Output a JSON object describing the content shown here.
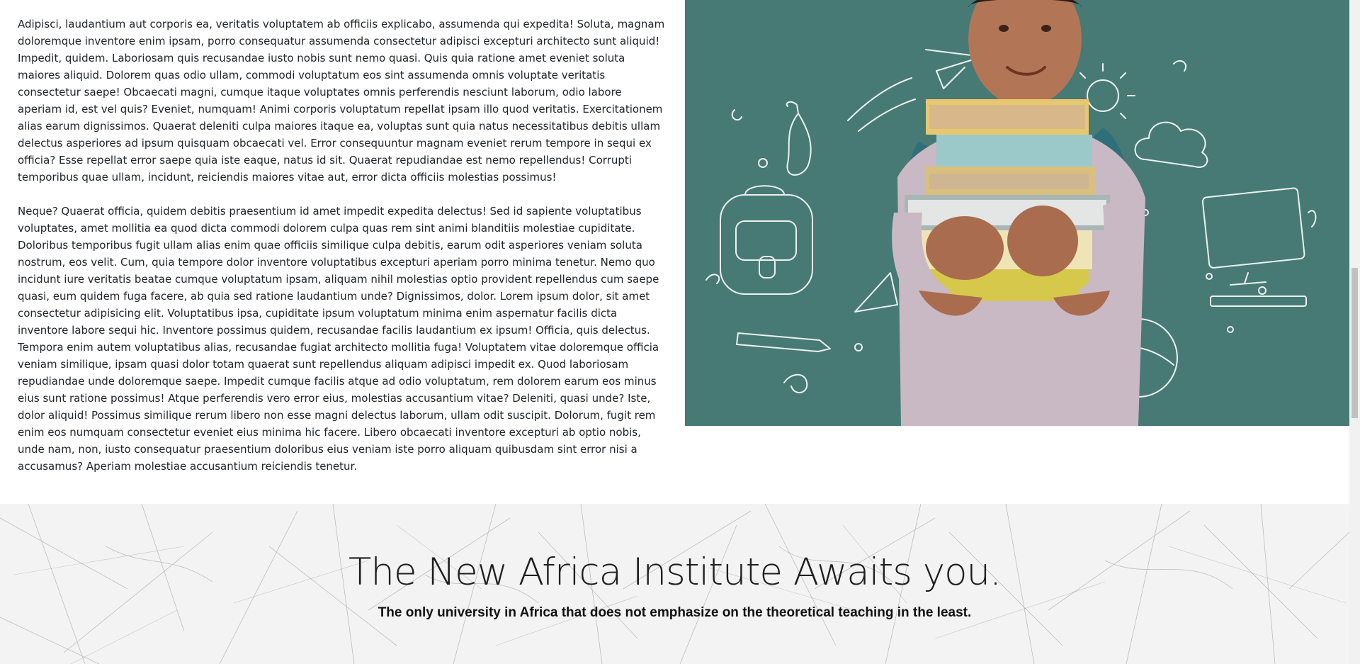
{
  "article": {
    "paragraphs": [
      "Adipisci, laudantium aut corporis ea, veritatis voluptatem ab officiis explicabo, assumenda qui expedita! Soluta, magnam doloremque inventore enim ipsam, porro consequatur assumenda consectetur adipisci excepturi architecto sunt aliquid! Impedit, quidem. Laboriosam quis recusandae iusto nobis sunt nemo quasi. Quis quia ratione amet eveniet soluta maiores aliquid. Dolorem quas odio ullam, commodi voluptatum eos sint assumenda omnis voluptate veritatis consectetur saepe! Obcaecati magni, cumque itaque voluptates omnis perferendis nesciunt laborum, odio labore aperiam id, est vel quis? Eveniet, numquam! Animi corporis voluptatum repellat ipsam illo quod veritatis. Exercitationem alias earum dignissimos. Quaerat deleniti culpa maiores itaque ea, voluptas sunt quia natus necessitatibus debitis ullam delectus asperiores ad ipsum quisquam obcaecati vel. Error consequuntur magnam eveniet rerum tempore in sequi ex officia? Esse repellat error saepe quia iste eaque, natus id sit. Quaerat repudiandae est nemo repellendus! Corrupti temporibus quae ullam, incidunt, reiciendis maiores vitae aut, error dicta officiis molestias possimus!",
      "Neque? Quaerat officia, quidem debitis praesentium id amet impedit expedita delectus! Sed id sapiente voluptatibus voluptates, amet mollitia ea quod dicta commodi dolorem culpa quas rem sint animi blanditiis molestiae cupiditate. Doloribus temporibus fugit ullam alias enim quae officiis similique culpa debitis, earum odit asperiores veniam soluta nostrum, eos velit. Cum, quia tempore dolor inventore voluptatibus excepturi aperiam porro minima tenetur. Nemo quo incidunt iure veritatis beatae cumque voluptatum ipsam, aliquam nihil molestias optio provident repellendus cum saepe quasi, eum quidem fuga facere, ab quia sed ratione laudantium unde? Dignissimos, dolor. Lorem ipsum dolor, sit amet consectetur adipisicing elit. Voluptatibus ipsa, cupiditate ipsum voluptatum minima enim aspernatur facilis dicta inventore labore sequi hic. Inventore possimus quidem, recusandae facilis laudantium ex ipsum! Officia, quis delectus. Tempora enim autem voluptatibus alias, recusandae fugiat architecto mollitia fuga! Voluptatem vitae doloremque officia veniam similique, ipsam quasi dolor totam quaerat sunt repellendus aliquam adipisci impedit ex. Quod laboriosam repudiandae unde doloremque saepe. Impedit cumque facilis atque ad odio voluptatum, rem dolorem earum eos minus eius sunt ratione possimus! Atque perferendis vero error eius, molestias accusantium vitae? Deleniti, quasi unde? Iste, dolor aliquid! Possimus similique rerum libero non esse magni delectus laborum, ullam odit suscipit. Dolorum, fugit rem enim eos numquam consectetur eveniet eius minima hic facere. Libero obcaecati inventore excepturi ab optio nobis, unde nam, non, iusto consequatur praesentium doloribus eius veniam iste porro aliquam quibusdam sint error nisi a accusamus? Aperiam molestiae accusantium reiciendis tenetur."
    ]
  },
  "hero": {
    "background_color": "#477a74",
    "icon": "student-holding-books-illustration"
  },
  "cta": {
    "title": "The New Africa Institute Awaits you.",
    "subtitle": "The only university in Africa that does not emphasize on the theoretical teaching in the least."
  },
  "colors": {
    "text": "#212529",
    "cta_background": "#f3f3f3"
  }
}
